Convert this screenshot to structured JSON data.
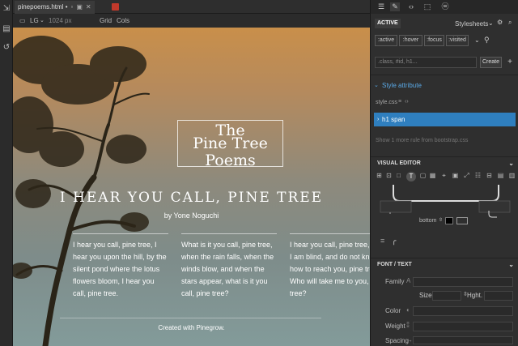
{
  "file_tab": {
    "title": "pinepoems.html •"
  },
  "view_toolbar": {
    "device": "LG",
    "width": "1024 px",
    "grid": "Grid",
    "cols": "Cols"
  },
  "page": {
    "title_line1": "The",
    "title_line2": "Pine Tree",
    "title_line3": "Poems",
    "headline": "I HEAR YOU CALL, PINE TREE",
    "byline": "by Yone Noguchi",
    "columns": [
      "I hear you call, pine tree, I hear you upon the hill, by the silent pond where the lotus flowers bloom, I hear you call, pine tree.",
      "What is it you call, pine tree, when the rain falls, when the winds blow, and when the stars appear, what is it you call, pine tree?",
      "I hear you call, pine tree, but I am blind, and do not know how to reach you, pine tree. Who will take me to you, pine tree?"
    ],
    "footer": "Created with Pinegrow."
  },
  "panel": {
    "active_label": "ACTIVE",
    "stylesheets_label": "Stylesheets",
    "pseudo_classes": [
      ":active",
      ":hover",
      ":focus",
      ":visited"
    ],
    "class_placeholder": ".class, #id, h1...",
    "create_label": "Create",
    "style_attribute_label": "Style attribute",
    "stylesheet_file": "style.css",
    "selected_rule": "h1 span",
    "show_more": "Show 1 more rule from bootstrap.css",
    "visual_editor_title": "VISUAL EDITOR",
    "bottom_label": "bottom",
    "font_section_title": "FONT / TEXT",
    "family_label": "Family",
    "size_label": "Size",
    "height_label": "Hght.",
    "color_label": "Color",
    "weight_label": "Weight",
    "spacing_label": "Spacing"
  }
}
